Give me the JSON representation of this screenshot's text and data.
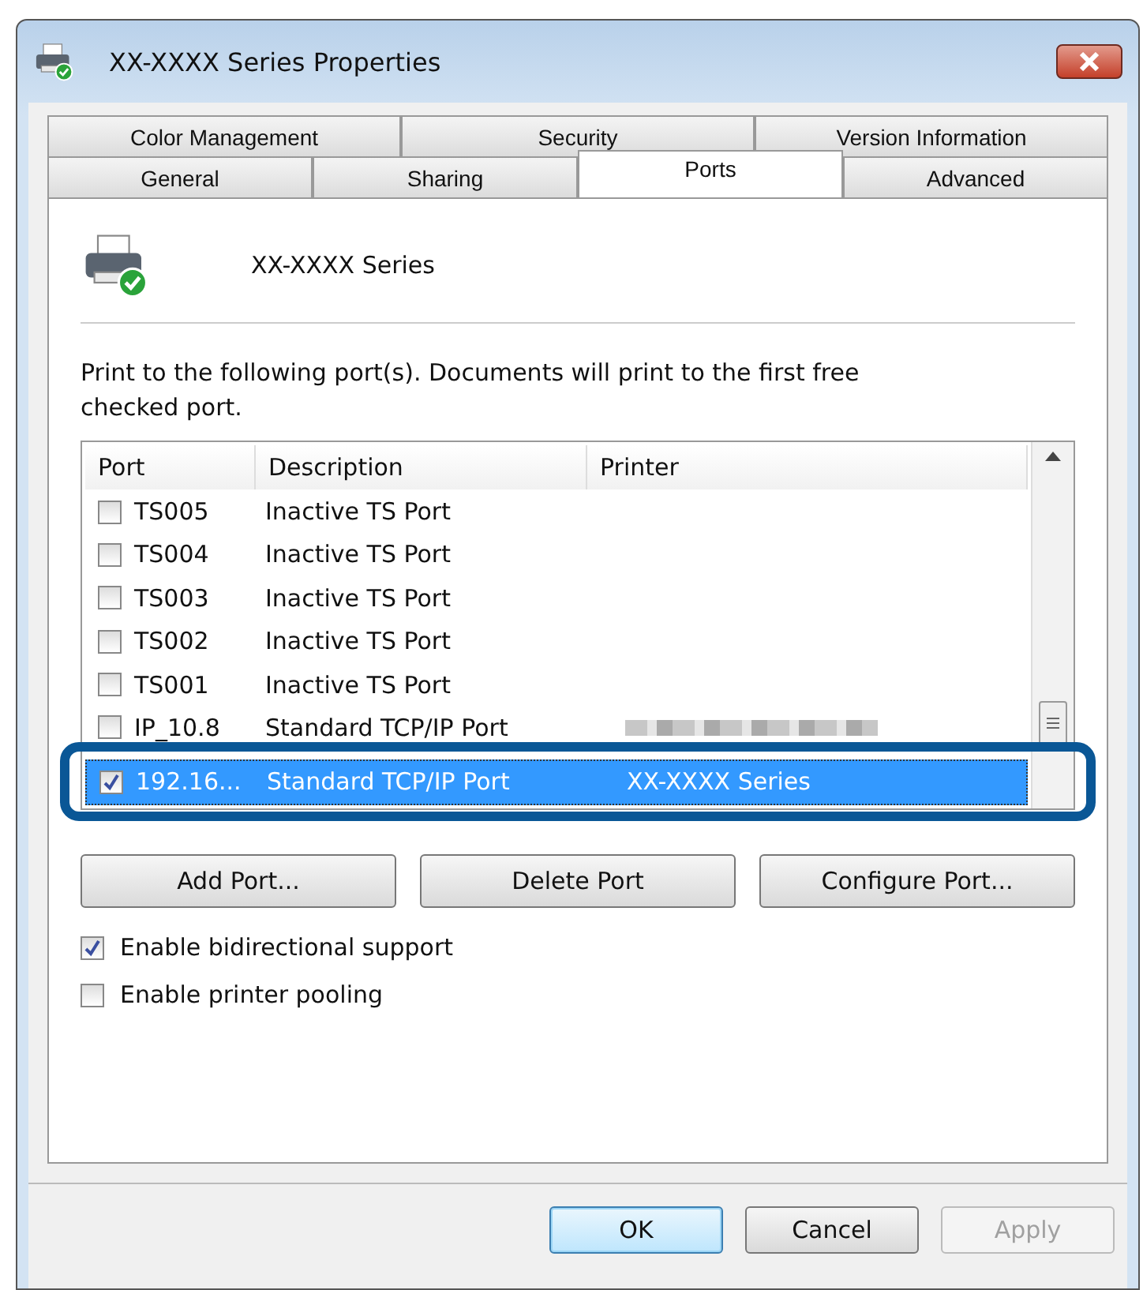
{
  "window": {
    "title": "XX-XXXX   Series Properties"
  },
  "tabs": [
    [
      {
        "label": "Color Management",
        "selected": false
      },
      {
        "label": "Security",
        "selected": false
      },
      {
        "label": "Version Information",
        "selected": false
      }
    ],
    [
      {
        "label": "General",
        "selected": false
      },
      {
        "label": "Sharing",
        "selected": false
      },
      {
        "label": "Ports",
        "selected": true
      },
      {
        "label": "Advanced",
        "selected": false
      }
    ]
  ],
  "printer_name": "XX-XXXX   Series",
  "instructions": "Print to the following port(s). Documents will print to the first free checked port.",
  "table": {
    "columns": [
      "Port",
      "Description",
      "Printer"
    ],
    "rows": [
      {
        "port": "TS005",
        "description": "Inactive TS Port",
        "printer": "",
        "checked": false,
        "selected": false,
        "blurred": false
      },
      {
        "port": "TS004",
        "description": "Inactive TS Port",
        "printer": "",
        "checked": false,
        "selected": false,
        "blurred": false
      },
      {
        "port": "TS003",
        "description": "Inactive TS Port",
        "printer": "",
        "checked": false,
        "selected": false,
        "blurred": false
      },
      {
        "port": "TS002",
        "description": "Inactive TS Port",
        "printer": "",
        "checked": false,
        "selected": false,
        "blurred": false
      },
      {
        "port": "TS001",
        "description": "Inactive TS Port",
        "printer": "",
        "checked": false,
        "selected": false,
        "blurred": false
      },
      {
        "port": "IP_10.8",
        "description": "Standard TCP/IP Port",
        "printer": "",
        "checked": false,
        "selected": false,
        "blurred": true
      },
      {
        "port": "192.16...",
        "description": "Standard TCP/IP Port",
        "printer": "XX-XXXX    Series",
        "checked": true,
        "selected": true,
        "blurred": false
      }
    ]
  },
  "port_buttons": [
    "Add Port...",
    "Delete Port",
    "Configure Port..."
  ],
  "options": [
    {
      "label": "Enable bidirectional support",
      "checked": true
    },
    {
      "label": "Enable printer pooling",
      "checked": false
    }
  ],
  "buttons": [
    {
      "label": "OK",
      "kind": "default",
      "disabled": false
    },
    {
      "label": "Cancel",
      "kind": "normal",
      "disabled": false
    },
    {
      "label": "Apply",
      "kind": "normal",
      "disabled": true
    }
  ]
}
